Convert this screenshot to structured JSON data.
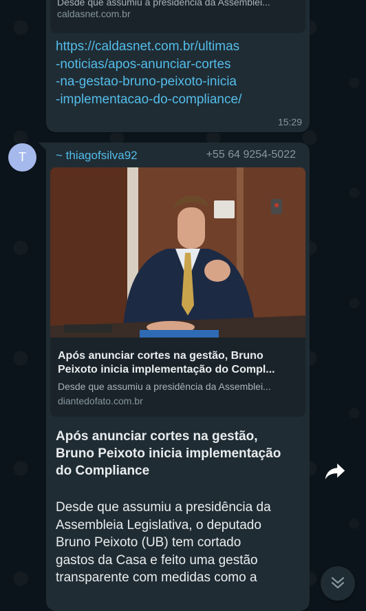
{
  "messages": [
    {
      "preview": {
        "description": "Desde que assumiu a presidência da Assemblei...",
        "domain": "caldasnet.com.br"
      },
      "link_lines": [
        "https://caldasnet.com.br/ultimas",
        "-noticias/apos-anunciar-cortes",
        "-na-gestao-bruno-peixoto-inicia",
        "-implementacao-do-compliance/"
      ],
      "time": "15:29"
    },
    {
      "avatar_letter": "T",
      "sender": "~ thiagofsilva92",
      "phone": "+55 64 9254-5022",
      "preview": {
        "title_lines": [
          "Após anunciar cortes na gestão, Bruno",
          "Peixoto inicia implementação do Compl..."
        ],
        "description": "Desde que assumiu a presidência da Assemblei...",
        "domain": "diantedofato.com.br"
      },
      "headline_lines": [
        "Após anunciar cortes na gestão,",
        "Bruno Peixoto inicia implementação",
        "do Compliance"
      ],
      "body_lines": [
        "Desde que assumiu a presidência da",
        "Assembleia Legislativa, o deputado",
        "Bruno Peixoto (UB) tem cortado",
        "gastos da Casa e feito uma gestão",
        "transparente com medidas como a"
      ]
    }
  ],
  "icons": {
    "share": "share-forward-icon",
    "scroll_down": "chevron-double-down-icon"
  },
  "colors": {
    "background": "#0b141a",
    "bubble": "#202c33",
    "link": "#53bdeb",
    "avatar": "#a6b9ec"
  }
}
